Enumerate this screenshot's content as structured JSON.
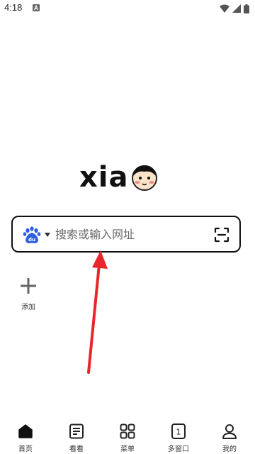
{
  "status_bar": {
    "time": "4:18",
    "icons": [
      "a-notification-icon",
      "wifi-icon",
      "signal-icon",
      "battery-icon"
    ]
  },
  "logo": {
    "text": "xia",
    "icon": "cartoon-face-icon"
  },
  "search": {
    "engine_icon": "baidu-icon",
    "placeholder": "搜索或输入网址",
    "value": "",
    "scan_icon": "scan-icon"
  },
  "shortcuts": {
    "add_label": "添加"
  },
  "bottom_nav": {
    "items": [
      {
        "label": "首页",
        "icon": "home-icon"
      },
      {
        "label": "看看",
        "icon": "news-icon"
      },
      {
        "label": "菜单",
        "icon": "menu-grid-icon"
      },
      {
        "label": "多窗口",
        "icon": "windows-icon",
        "count": "1"
      },
      {
        "label": "我的",
        "icon": "profile-icon"
      }
    ]
  },
  "colors": {
    "annotation_red": "#e8262b",
    "baidu_blue": "#2e5fe0",
    "text": "#111111"
  }
}
